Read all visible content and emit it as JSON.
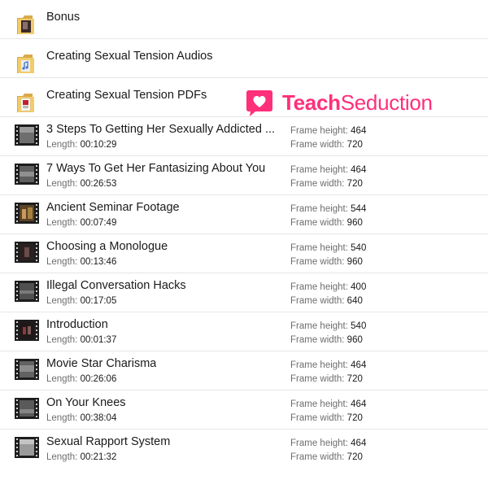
{
  "labels": {
    "length": "Length:",
    "frame_height": "Frame height:",
    "frame_width": "Frame width:"
  },
  "folders": [
    {
      "name": "Bonus",
      "icon": "folder-icon"
    },
    {
      "name": "Creating Sexual Tension Audios",
      "icon": "folder-icon"
    },
    {
      "name": "Creating Sexual Tension PDFs",
      "icon": "folder-icon"
    }
  ],
  "videos": [
    {
      "name": "3 Steps To Getting Her Sexually Addicted ...",
      "length": "00:10:29",
      "frame_height": "464",
      "frame_width": "720"
    },
    {
      "name": "7 Ways To Get Her Fantasizing About You",
      "length": "00:26:53",
      "frame_height": "464",
      "frame_width": "720"
    },
    {
      "name": "Ancient Seminar Footage",
      "length": "00:07:49",
      "frame_height": "544",
      "frame_width": "960"
    },
    {
      "name": "Choosing a Monologue",
      "length": "00:13:46",
      "frame_height": "540",
      "frame_width": "960"
    },
    {
      "name": "Illegal Conversation Hacks",
      "length": "00:17:05",
      "frame_height": "400",
      "frame_width": "640"
    },
    {
      "name": "Introduction",
      "length": "00:01:37",
      "frame_height": "540",
      "frame_width": "960"
    },
    {
      "name": "Movie Star Charisma",
      "length": "00:26:06",
      "frame_height": "464",
      "frame_width": "720"
    },
    {
      "name": "On Your Knees",
      "length": "00:38:04",
      "frame_height": "464",
      "frame_width": "720"
    },
    {
      "name": "Sexual Rapport System",
      "length": "00:21:32",
      "frame_height": "464",
      "frame_width": "720"
    }
  ],
  "watermark": {
    "text_bold": "Teach",
    "text_regular": "Seduction",
    "color": "#ff2f7a",
    "icon": "heart-bubble-icon"
  }
}
